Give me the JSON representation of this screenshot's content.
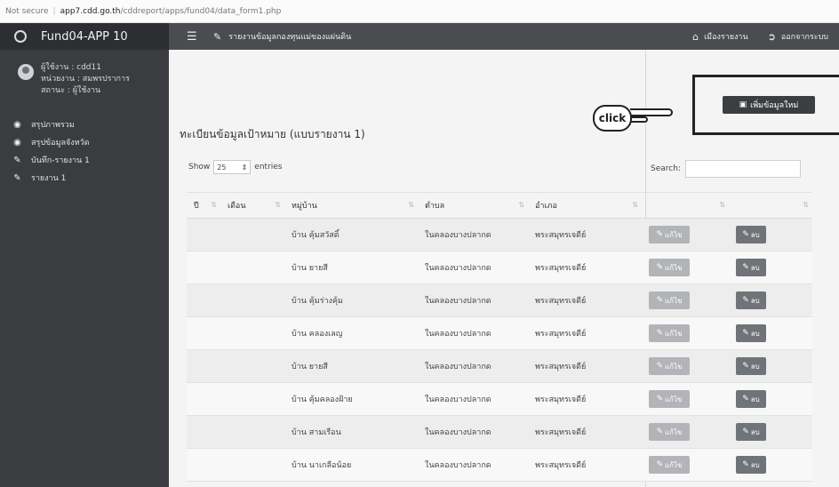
{
  "browser": {
    "security": "Not secure",
    "host": "app7.cdd.go.th",
    "path": "/cddreport/apps/fund04/data_form1.php"
  },
  "sidebar": {
    "brand": "Fund04-APP 10",
    "user": {
      "line1": "ผู้ใช้งาน : cdd11",
      "line2": "หน่วยงาน : สมพรปราการ",
      "line3": "สถานะ : ผู้ใช้งาน"
    },
    "items": [
      {
        "label": "สรุปภาพรวม",
        "icon": "dashboard-icon"
      },
      {
        "label": "สรุปข้อมูลจังหวัด",
        "icon": "dashboard-icon"
      },
      {
        "label": "บันทึก-รายงาน 1",
        "icon": "edit-icon"
      },
      {
        "label": "รายงาน 1",
        "icon": "edit-icon"
      }
    ]
  },
  "header": {
    "title": "รายงานข้อมูลกองทุนแม่ของแผ่นดิน",
    "home_label": "เมืองรายงาน",
    "logout_label": "ออกจากระบบ"
  },
  "main": {
    "add_button": "เพิ่มข้อมูลใหม่",
    "annotation": "click",
    "page_title": "ทะเบียนข้อมูลเป้าหมาย (แบบรายงาน 1)",
    "show_label": "Show",
    "entries_value": "25",
    "entries_label": "entries",
    "search_label": "Search:",
    "search_value": ""
  },
  "table": {
    "columns": [
      "ปี",
      "เดือน",
      "หมู่บ้าน",
      "ตำบล",
      "อำเภอ",
      "",
      ""
    ],
    "edit_label": "แก้ไข",
    "delete_label": "ลบ",
    "rows": [
      {
        "year": "",
        "month": "",
        "village": "บ้าน คุ้มสวัสดิ์",
        "tambon": "ในคลองบางปลากด",
        "amphoe": "พระสมุทรเจดีย์"
      },
      {
        "year": "",
        "month": "",
        "village": "บ้าน ยายสี",
        "tambon": "ในคลองบางปลากด",
        "amphoe": "พระสมุทรเจดีย์"
      },
      {
        "year": "",
        "month": "",
        "village": "บ้าน คุ้มร่างคุ้ม",
        "tambon": "ในคลองบางปลากด",
        "amphoe": "พระสมุทรเจดีย์"
      },
      {
        "year": "",
        "month": "",
        "village": "บ้าน คลองเลญ",
        "tambon": "ในคลองบางปลากด",
        "amphoe": "พระสมุทรเจดีย์"
      },
      {
        "year": "",
        "month": "",
        "village": "บ้าน ยายสี",
        "tambon": "ในคลองบางปลากด",
        "amphoe": "พระสมุทรเจดีย์"
      },
      {
        "year": "",
        "month": "",
        "village": "บ้าน คุ้มคลองฝ้าย",
        "tambon": "ในคลองบางปลากด",
        "amphoe": "พระสมุทรเจดีย์"
      },
      {
        "year": "",
        "month": "",
        "village": "บ้าน สามเรือน",
        "tambon": "ในคลองบางปลากด",
        "amphoe": "พระสมุทรเจดีย์"
      },
      {
        "year": "",
        "month": "",
        "village": "บ้าน นาเกลือน้อย",
        "tambon": "ในคลองบางปลากด",
        "amphoe": "พระสมุทรเจดีย์"
      }
    ]
  },
  "colors": {
    "sidebar_bg": "#3a3c40",
    "topbar_bg": "#4a4c50",
    "edit_btn": "#b2b4b7",
    "delete_btn": "#707377"
  }
}
